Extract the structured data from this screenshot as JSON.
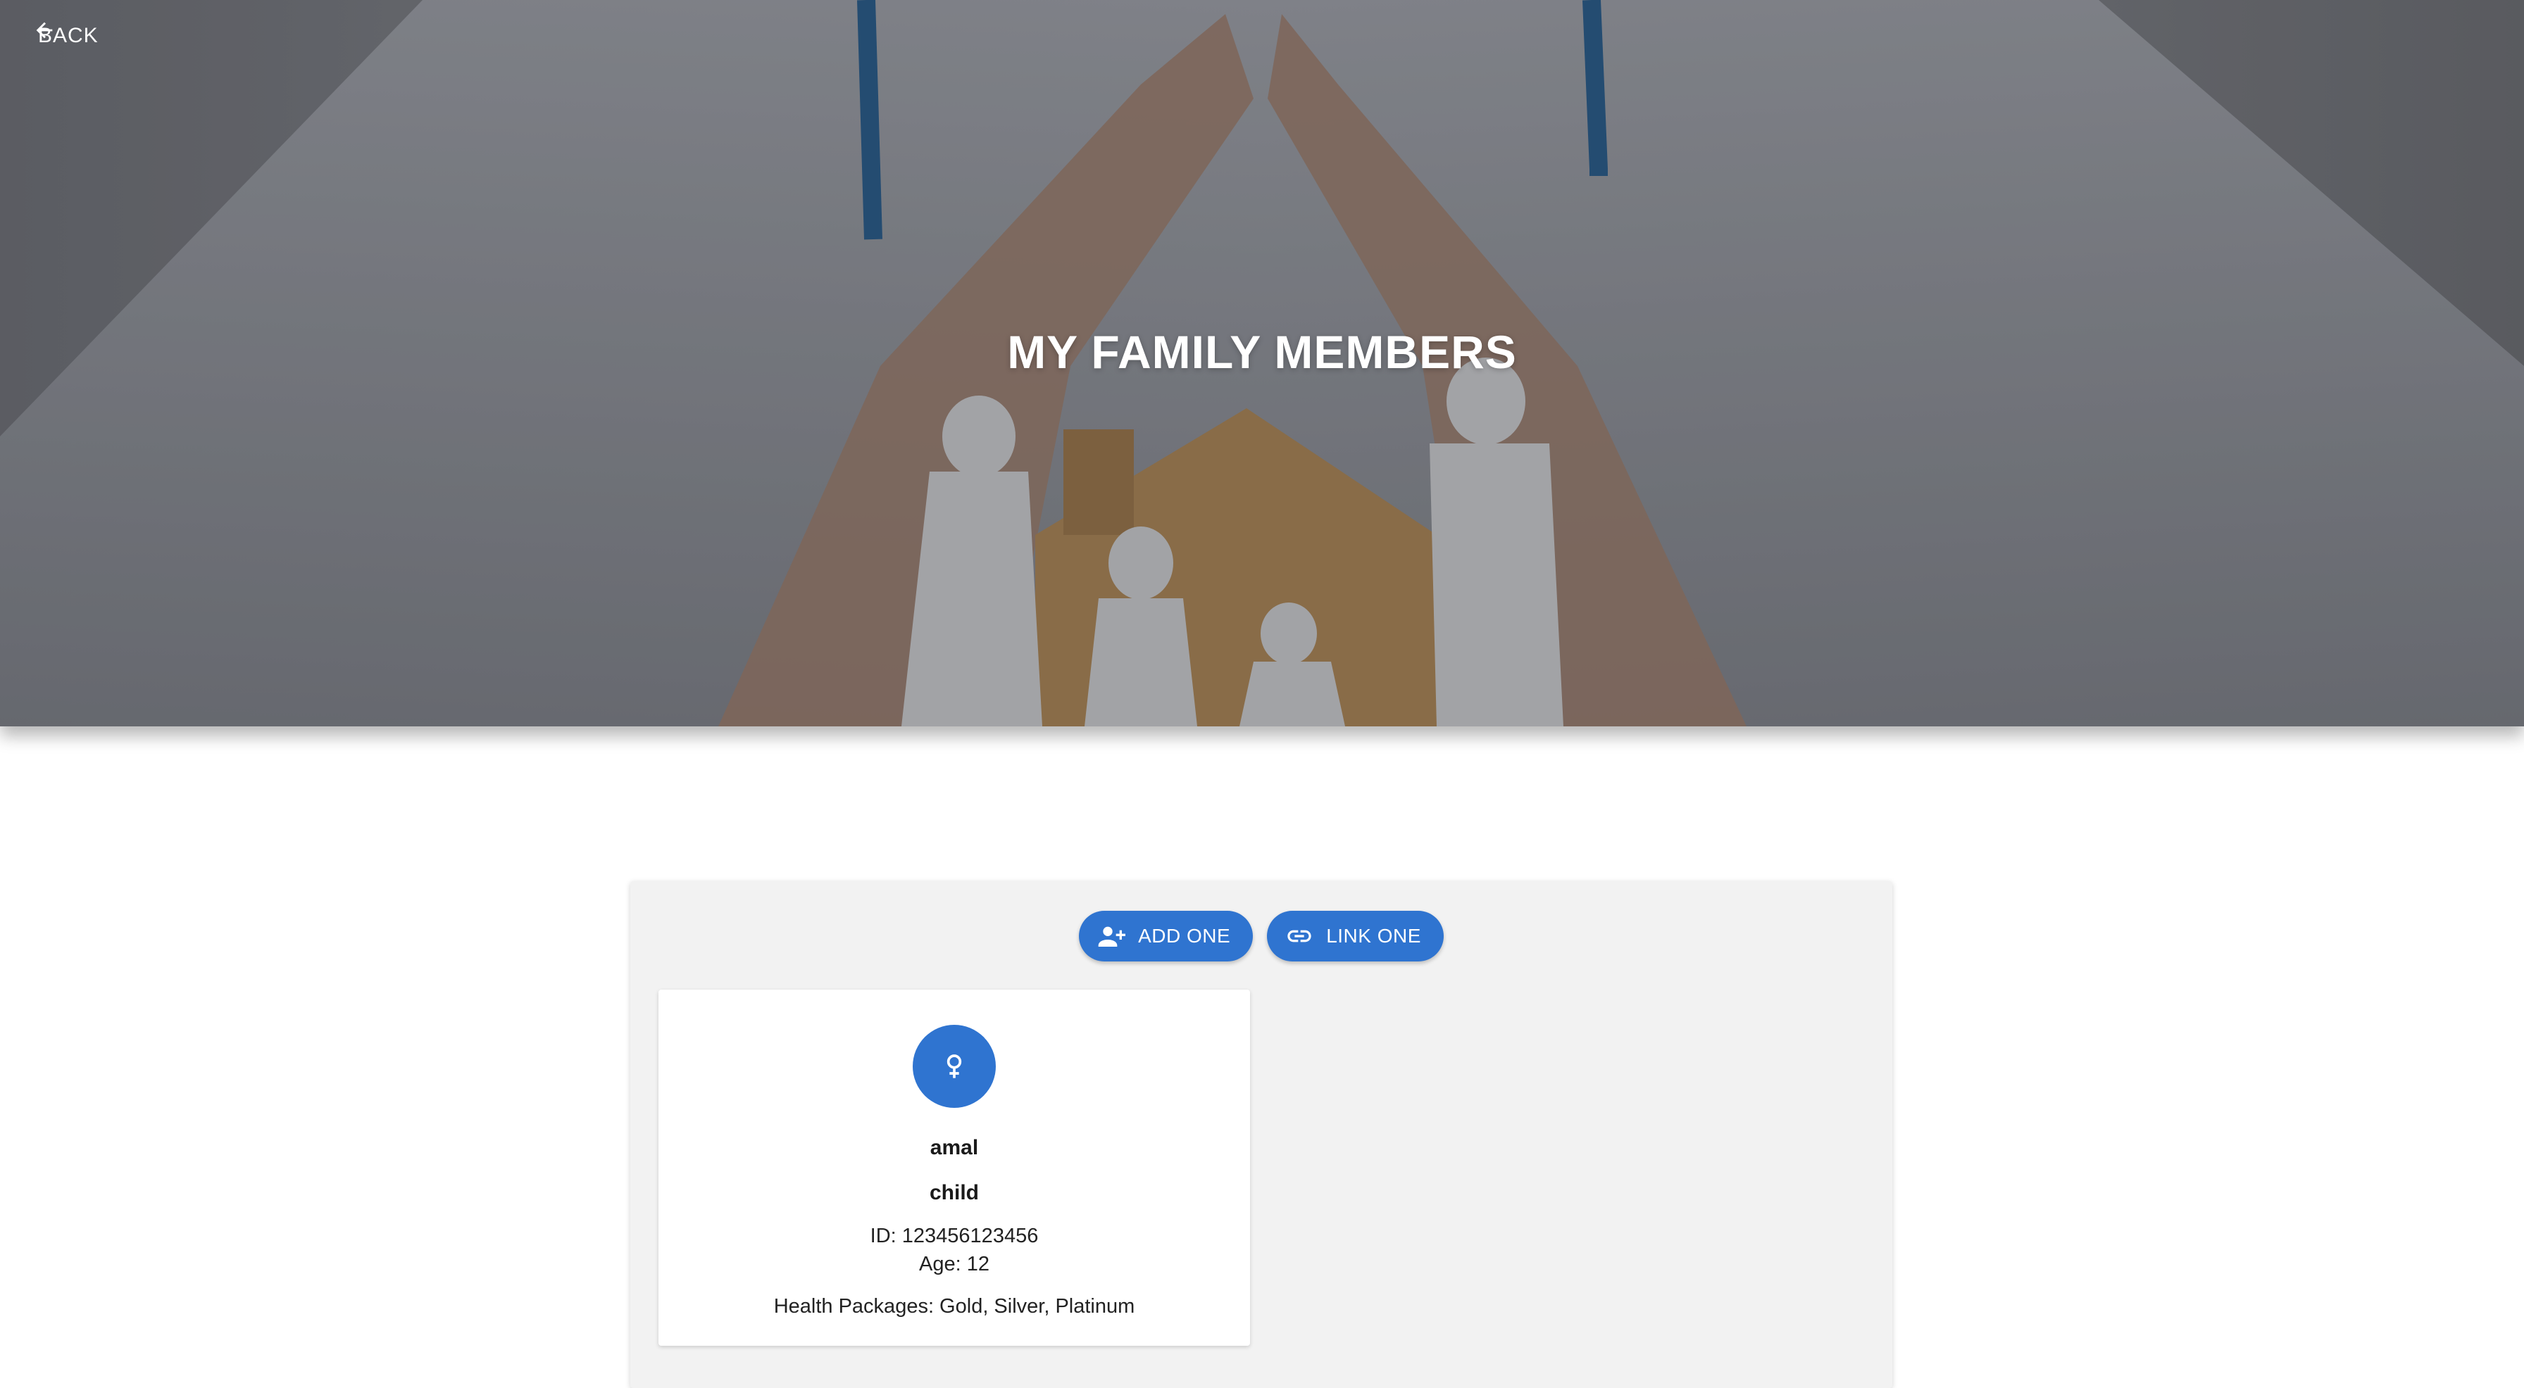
{
  "header": {
    "back_label": "BACK",
    "title": "MY FAMILY MEMBERS"
  },
  "actions": {
    "add_label": "ADD ONE",
    "link_label": "LINK ONE"
  },
  "members": [
    {
      "name": "amal",
      "relation": "child",
      "id_line": "ID: 123456123456",
      "age_line": "Age: 12",
      "packages_line": "Health Packages: Gold, Silver, Platinum",
      "gender_icon": "female-icon"
    }
  ],
  "colors": {
    "accent": "#2f74d0",
    "panel_bg": "#f2f2f2",
    "card_bg": "#ffffff"
  }
}
